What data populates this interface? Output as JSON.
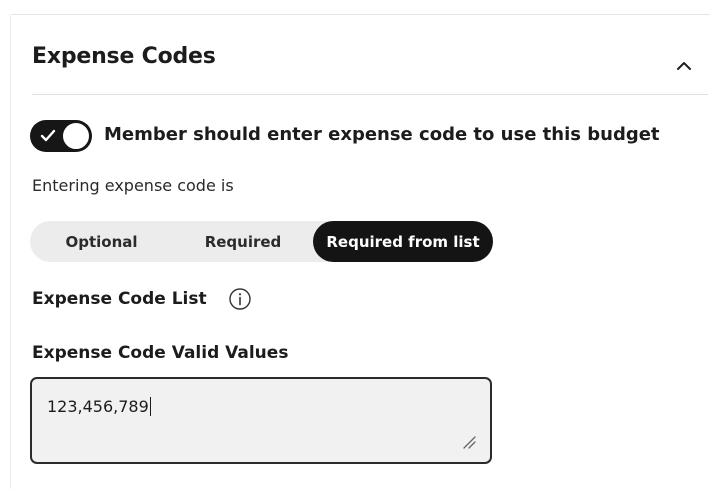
{
  "section": {
    "title": "Expense Codes",
    "collapse_icon": "chevron-up-icon"
  },
  "toggle": {
    "on": true,
    "icon": "check-icon",
    "label": "Member should enter expense code to use this budget"
  },
  "entry_mode": {
    "label": "Entering expense code is",
    "options": [
      "Optional",
      "Required",
      "Required from list"
    ],
    "selected": "Required from list"
  },
  "code_list": {
    "label": "Expense Code List",
    "info_icon": "info-icon"
  },
  "valid_values": {
    "label": "Expense Code Valid Values",
    "value": "123,456,789"
  },
  "colors": {
    "accent": "#141414",
    "segment_bg": "#ececec",
    "textarea_bg": "#f1f1f1"
  }
}
